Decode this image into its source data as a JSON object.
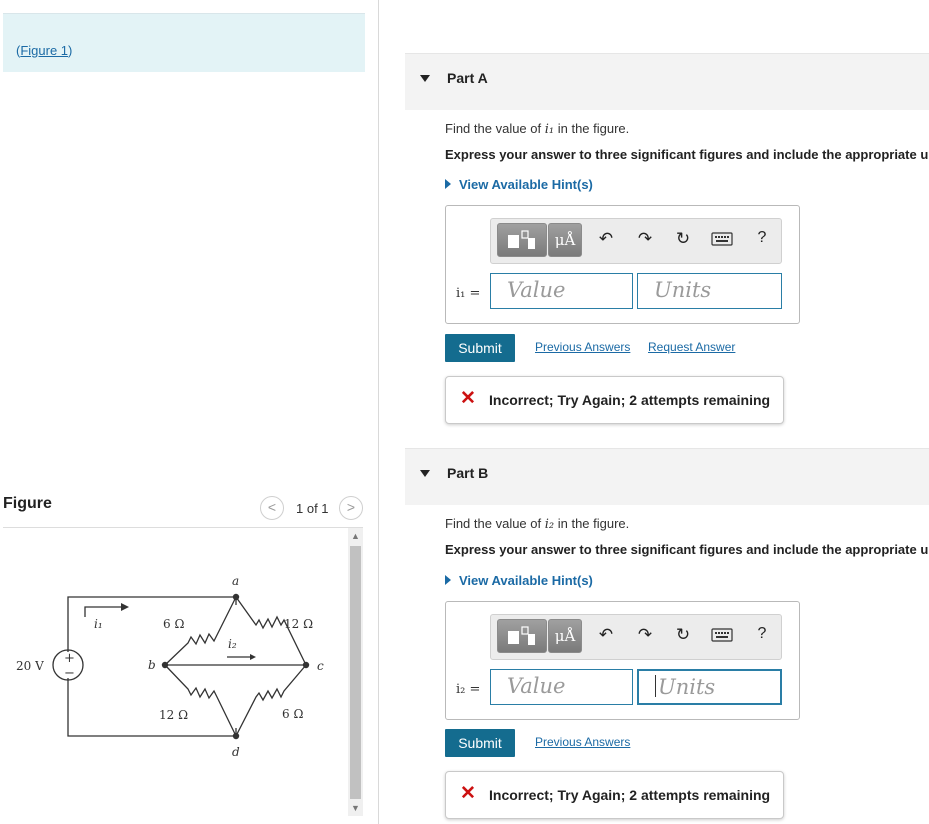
{
  "figure_link": {
    "open": "(",
    "label": "Figure 1",
    "close": ")"
  },
  "figure_panel": {
    "title": "Figure",
    "pager_text": "1 of 1",
    "prev_icon": "<",
    "next_icon": ">"
  },
  "circuit": {
    "source_label": "20 V",
    "plus": "+",
    "minus": "−",
    "current_i1": "i₁",
    "current_i2": "i₂",
    "node_a": "a",
    "node_b": "b",
    "node_c": "c",
    "node_d": "d",
    "r_ab": "6 Ω",
    "r_ac": "12 Ω",
    "r_bd": "12 Ω",
    "r_cd": "6 Ω"
  },
  "part_a": {
    "label": "Part A",
    "prompt_pre": "Find the value of ",
    "prompt_var": "i₁",
    "prompt_post": " in the figure.",
    "instruction": "Express your answer to three significant figures and include the appropriate units.",
    "hint_label": "View Available Hint(s)",
    "var_label": "i₁ =",
    "value_placeholder": "Value",
    "units_placeholder": "Units",
    "submit_label": "Submit",
    "previous_answers": "Previous Answers",
    "request_answer": "Request Answer",
    "feedback_icon": "✕",
    "feedback": "Incorrect; Try Again; 2 attempts remaining"
  },
  "part_b": {
    "label": "Part B",
    "prompt_pre": "Find the value of ",
    "prompt_var": "i₂",
    "prompt_post": " in the figure.",
    "instruction": "Express your answer to three significant figures and include the appropriate units.",
    "hint_label": "View Available Hint(s)",
    "var_label": "i₂ =",
    "value_placeholder": "Value",
    "units_placeholder": "Units",
    "submit_label": "Submit",
    "previous_answers": "Previous Answers",
    "feedback_icon": "✕",
    "feedback": "Incorrect; Try Again; 2 attempts remaining"
  },
  "toolbar": {
    "units_symbol": "μÅ",
    "undo_icon": "↶",
    "redo_icon": "↷",
    "reset_icon": "↻",
    "help": "?"
  },
  "colors": {
    "accent": "#146c8f",
    "link": "#1b6aa5",
    "error": "#cc1111",
    "panel_bg": "#e3f3f6"
  }
}
